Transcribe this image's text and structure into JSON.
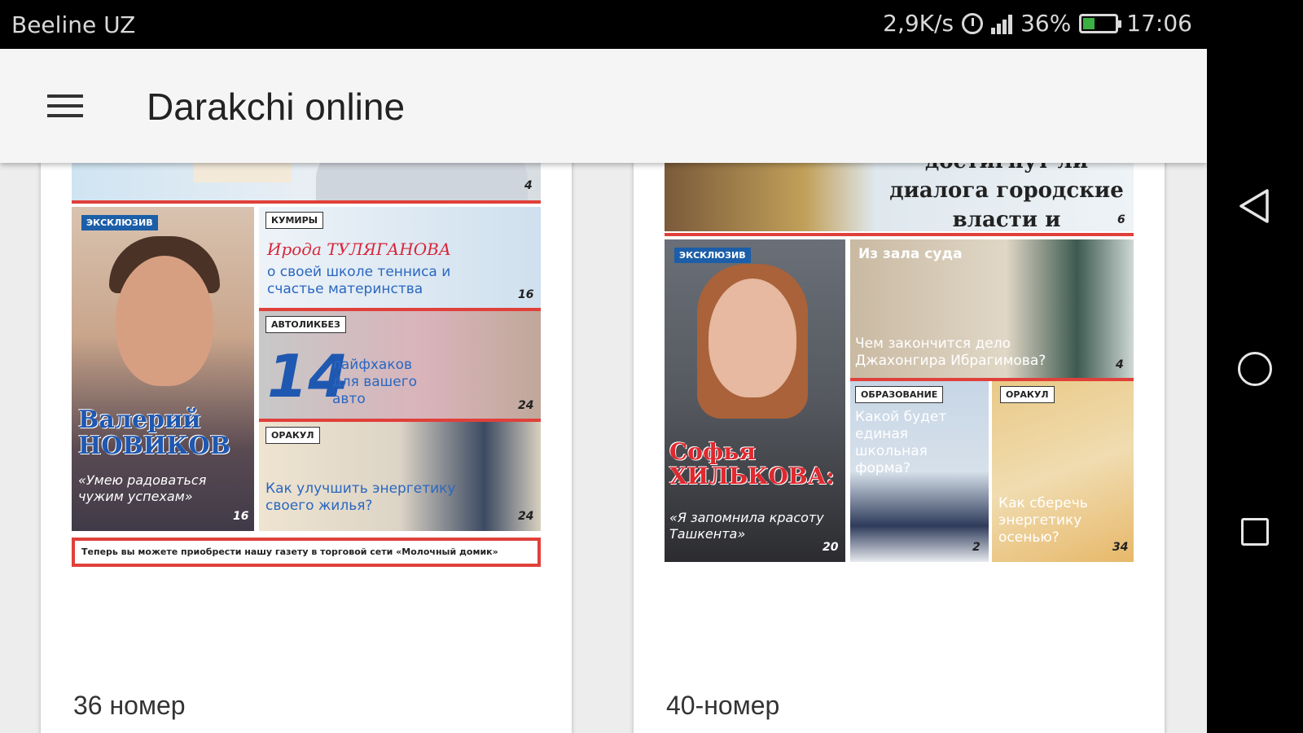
{
  "status_bar": {
    "carrier": "Beeline UZ",
    "speed": "2,9K/s",
    "battery_percent": "36%",
    "battery_level": 0.36,
    "time": "17:06"
  },
  "toolbar": {
    "title": "Darakchi online",
    "menu_icon": "hamburger-menu-icon"
  },
  "issues": [
    {
      "label": "36 номер",
      "cover": {
        "tag_exclusive": "ЭКСКЛЮЗИВ",
        "person_name": "Валерий НОВИКОВ",
        "person_quote": "«Умею радоваться чужим успехам»",
        "person_page": "16",
        "section_idols": "КУМИРЫ",
        "idols_name": "Ирода ТУЛЯГАНОВА",
        "idols_text": "о своей школе тенниса и счастье материнства",
        "idols_page": "16",
        "section_auto": "АВТОЛИКБЕЗ",
        "auto_number": "14",
        "auto_text": "лайфхаков для вашего авто",
        "auto_page": "24",
        "section_oracle": "ОРАКУЛ",
        "oracle_text": "Как улучшить энергетику своего жилья?",
        "oracle_page": "24",
        "top_page": "4",
        "banner": "Теперь вы можете приобрести нашу газету в торговой сети «Молочный домик»"
      }
    },
    {
      "label": "40-номер",
      "cover": {
        "headline": "достигнут ли диалога городские власти и зоозащитники?",
        "headline_page": "6",
        "tag_exclusive": "ЭКСКЛЮЗИВ",
        "person_name": "Софья ХИЛЬКОВА:",
        "person_quote": "«Я запомнила красоту Ташкента»",
        "person_page": "20",
        "section_court": "Из зала суда",
        "court_text": "Чем закончится дело Джахонгира Ибрагимова?",
        "court_page": "4",
        "section_education": "ОБРАЗОВАНИЕ",
        "education_text": "Какой будет единая школьная форма?",
        "education_page": "2",
        "section_oracle": "ОРАКУЛ",
        "oracle_text": "Как сберечь энергетику осенью?",
        "oracle_page": "34"
      }
    }
  ],
  "nav_bar": {
    "back_icon": "back-triangle-icon",
    "home_icon": "home-circle-icon",
    "recent_icon": "recent-apps-square-icon"
  },
  "colors": {
    "accent_blue": "#1f58b0",
    "accent_red": "#e0403a",
    "toolbar_bg": "#f5f5f5",
    "battery_green": "#3cb043"
  }
}
